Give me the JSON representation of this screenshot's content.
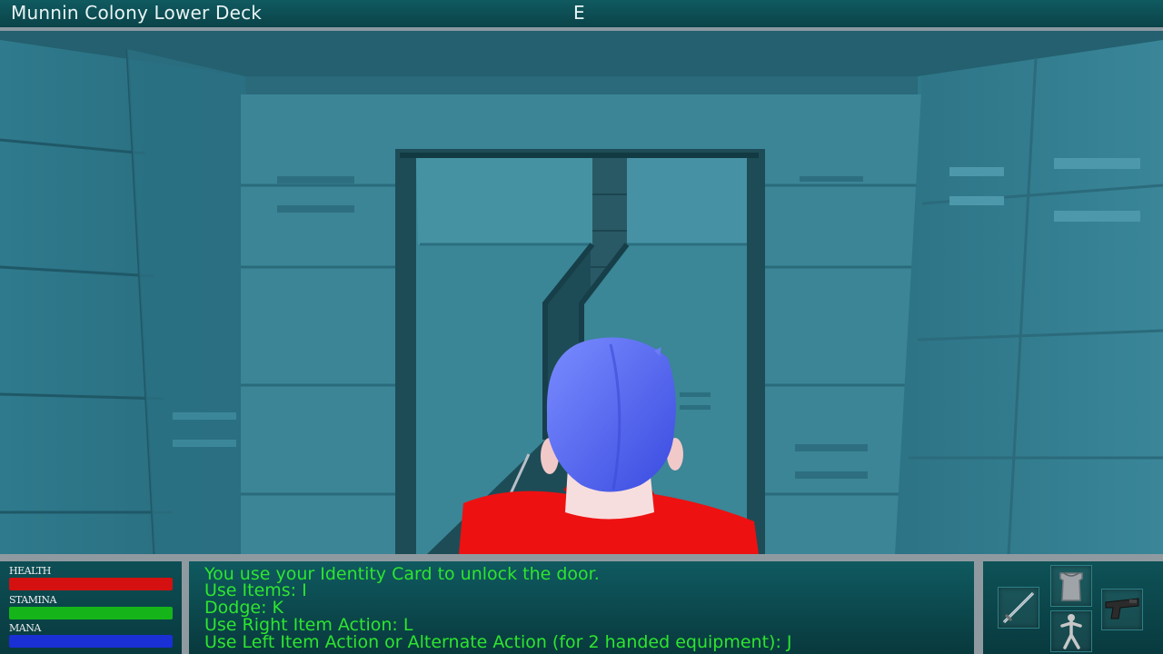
{
  "header": {
    "location": "Munnin Colony Lower Deck",
    "compass": "E"
  },
  "stats": {
    "health": {
      "label": "Health",
      "value": 1.0,
      "color": "#d41010"
    },
    "stamina": {
      "label": "Stamina",
      "value": 1.0,
      "color": "#15b51a"
    },
    "mana": {
      "label": "Mana",
      "value": 1.0,
      "color": "#1a2fd4"
    }
  },
  "messages": [
    "You use your Identity Card to unlock the door.",
    "Use Items: I",
    "Dodge: K",
    "Use Right Item Action: L",
    "Use Left Item Action or Alternate Action (for 2 handed equipment): J"
  ],
  "equipment": {
    "right_hand": "sword-icon",
    "armor": "armor-icon",
    "body": "character-figure-icon",
    "left_hand": "pistol-icon"
  },
  "colors": {
    "hud_panel": "#0b4f55",
    "message_text": "#2ee52e",
    "wall": "#2e7889",
    "hair": "#5a6cf0",
    "shirt": "#ee1111"
  }
}
